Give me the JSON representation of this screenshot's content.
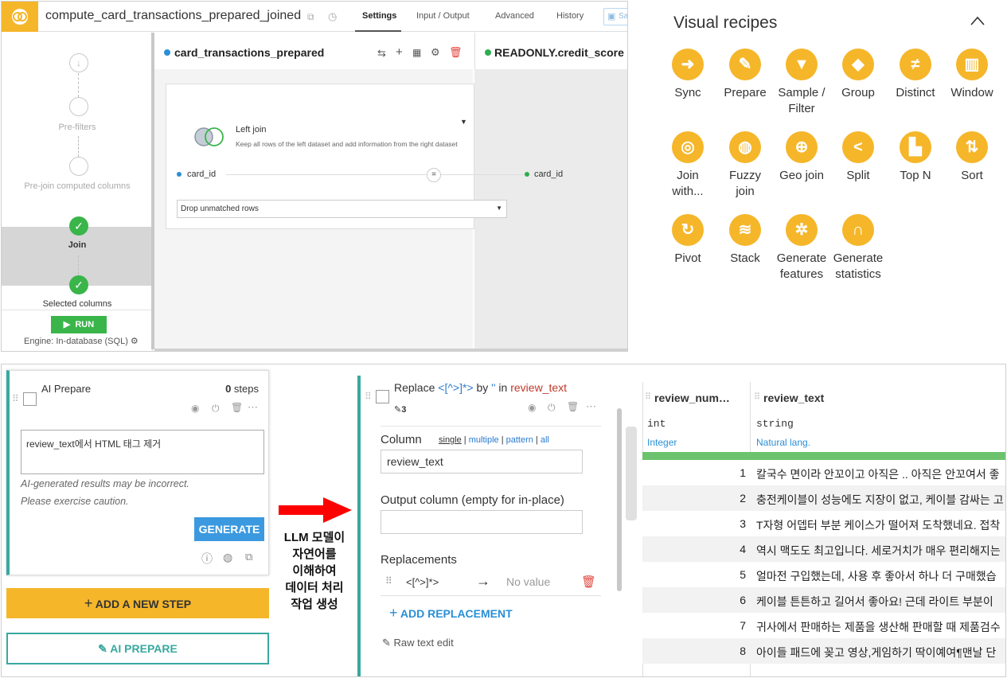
{
  "recipe": {
    "title": "compute_card_transactions_prepared_joined",
    "tabs": [
      "Settings",
      "Input / Output",
      "Advanced",
      "History"
    ],
    "save_label": "Sa"
  },
  "sidebar": {
    "prefilters": "Pre-filters",
    "prejoin": "Pre-join computed columns",
    "join": "Join",
    "selected": "Selected columns",
    "run": "RUN",
    "engine": "Engine: In-database (SQL)"
  },
  "join": {
    "left_dataset": "card_transactions_prepared",
    "right_dataset": "READONLY.credit_score",
    "type_label": "Left join",
    "type_desc": "Keep all rows of the left dataset and add information from the right dataset",
    "left_key": "card_id",
    "operator": "=",
    "right_key": "card_id",
    "unmatched_option": "Drop unmatched rows"
  },
  "visual_recipes": {
    "title": "Visual recipes",
    "items": [
      {
        "l1": "Sync",
        "l2": "",
        "icon": "sync-icon",
        "glyph": "➜"
      },
      {
        "l1": "Prepare",
        "l2": "",
        "icon": "brush-icon",
        "glyph": "✎"
      },
      {
        "l1": "Sample /",
        "l2": "Filter",
        "icon": "filter-icon",
        "glyph": "▼"
      },
      {
        "l1": "Group",
        "l2": "",
        "icon": "group-icon",
        "glyph": "◆"
      },
      {
        "l1": "Distinct",
        "l2": "",
        "icon": "not-equal-icon",
        "glyph": "≠"
      },
      {
        "l1": "Window",
        "l2": "",
        "icon": "window-icon",
        "glyph": "▥"
      },
      {
        "l1": "Join",
        "l2": "with...",
        "icon": "join-icon",
        "glyph": "◎"
      },
      {
        "l1": "Fuzzy",
        "l2": "join",
        "icon": "fuzzy-join-icon",
        "glyph": "◍"
      },
      {
        "l1": "Geo join",
        "l2": "",
        "icon": "globe-icon",
        "glyph": "⊕"
      },
      {
        "l1": "Split",
        "l2": "",
        "icon": "split-icon",
        "glyph": "<"
      },
      {
        "l1": "Top N",
        "l2": "",
        "icon": "top-n-icon",
        "glyph": "▙"
      },
      {
        "l1": "Sort",
        "l2": "",
        "icon": "sort-icon",
        "glyph": "⇅"
      },
      {
        "l1": "Pivot",
        "l2": "",
        "icon": "pivot-icon",
        "glyph": "↻"
      },
      {
        "l1": "Stack",
        "l2": "",
        "icon": "stack-icon",
        "glyph": "≋"
      },
      {
        "l1": "Generate",
        "l2": "features",
        "icon": "gear-sparkle-icon",
        "glyph": "✲"
      },
      {
        "l1": "Generate",
        "l2": "statistics",
        "icon": "bell-curve-icon",
        "glyph": "∩"
      }
    ]
  },
  "ai_prepare": {
    "title": "AI Prepare",
    "steps_count": "0",
    "steps_suffix": " steps",
    "prompt_value": "review_text에서  HTML 태그 제거",
    "caution1": "AI-generated results may be incorrect.",
    "caution2": "Please exercise caution.",
    "generate": "GENERATE",
    "add_step": "ADD A NEW STEP",
    "ai_prepare_btn": "AI PREPARE"
  },
  "annotation": {
    "lines": [
      "LLM 모델이",
      "자연어를",
      "이해하여",
      "데이터 처리",
      "작업 생성"
    ]
  },
  "replace_step": {
    "title_word": "Replace",
    "pattern": "<[^>]*>",
    "by_word": "by",
    "replacement": "''",
    "in_word": "in",
    "column_ref": "review_text",
    "edit_count": "3",
    "column_label": "Column",
    "modes": [
      "single",
      "multiple",
      "pattern",
      "all"
    ],
    "column_value": "review_text",
    "output_label": "Output column (empty for in-place)",
    "output_value": "",
    "replacements_label": "Replacements",
    "rep_pattern": "<[^>]*>",
    "rep_arrow": "→",
    "rep_value_placeholder": "No value",
    "add_replacement": "ADD REPLACEMENT",
    "raw_text_edit": "Raw text edit"
  },
  "table": {
    "columns": [
      {
        "name": "review_num…",
        "type": "int",
        "meaning": "Integer"
      },
      {
        "name": "review_text",
        "type": "string",
        "meaning": "Natural lang."
      }
    ],
    "rows": [
      {
        "num": "1",
        "text": "칼국수 면이라 안꼬이고 아직은 .. 아직은 안꼬여서 좋"
      },
      {
        "num": "2",
        "text": "충전케이블이 성능에도 지장이 없고, 케이블 감싸는 고"
      },
      {
        "num": "3",
        "text": "T자형 어뎁터 부분 케이스가 떨어져 도착했네요. 접착"
      },
      {
        "num": "4",
        "text": "역시 맥도도 최고입니다. 세로거치가 매우 편리해지는"
      },
      {
        "num": "5",
        "text": "얼마전 구입했는데, 사용 후 좋아서 하나 더 구매했습"
      },
      {
        "num": "6",
        "text": "케이블 튼튼하고 길어서 좋아요! 근데 라이트 부분이"
      },
      {
        "num": "7",
        "text": "귀사에서 판매하는 제품을 생산해 판매할 때 제품검수"
      },
      {
        "num": "8",
        "text": "아이들 패드에 꽂고 영상,게임하기 딱이예여¶맨날 단"
      }
    ]
  }
}
